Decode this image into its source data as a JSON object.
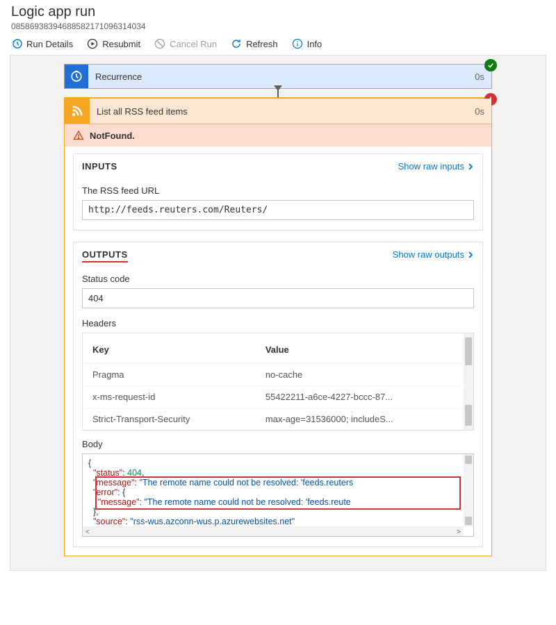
{
  "page": {
    "title": "Logic app run",
    "run_id": "08586938394688582171096314034"
  },
  "toolbar": {
    "run_details": "Run Details",
    "resubmit": "Resubmit",
    "cancel_run": "Cancel Run",
    "refresh": "Refresh",
    "info": "Info"
  },
  "trigger": {
    "title": "Recurrence",
    "duration": "0s",
    "status": "success"
  },
  "action": {
    "title": "List all RSS feed items",
    "duration": "0s",
    "status": "error",
    "error_text": "NotFound.",
    "inputs": {
      "section_label": "INPUTS",
      "show_raw_label": "Show raw inputs",
      "field_label": "The RSS feed URL",
      "field_value": "http://feeds.reuters.com/Reuters/"
    },
    "outputs": {
      "section_label": "OUTPUTS",
      "show_raw_label": "Show raw outputs",
      "status_code_label": "Status code",
      "status_code_value": "404",
      "headers_label": "Headers",
      "headers": {
        "col_key": "Key",
        "col_value": "Value",
        "rows": [
          {
            "key": "Pragma",
            "value": "no-cache"
          },
          {
            "key": "x-ms-request-id",
            "value": "55422211-a6ce-4227-bccc-87..."
          },
          {
            "key": "Strict-Transport-Security",
            "value": "max-age=31536000; includeS..."
          }
        ]
      },
      "body_label": "Body",
      "body_json": {
        "line1_key": "\"status\"",
        "line1_val": "404",
        "line2_key": "\"message\"",
        "line2_val": "\"The remote name could not be resolved: 'feeds.reuters",
        "line3_key": "\"error\"",
        "line4_key": "\"message\"",
        "line4_val": "\"The remote name could not be resolved: 'feeds.reute",
        "line6_key": "\"source\"",
        "line6_val": "\"rss-wus.azconn-wus.p.azurewebsites.net\""
      }
    }
  }
}
